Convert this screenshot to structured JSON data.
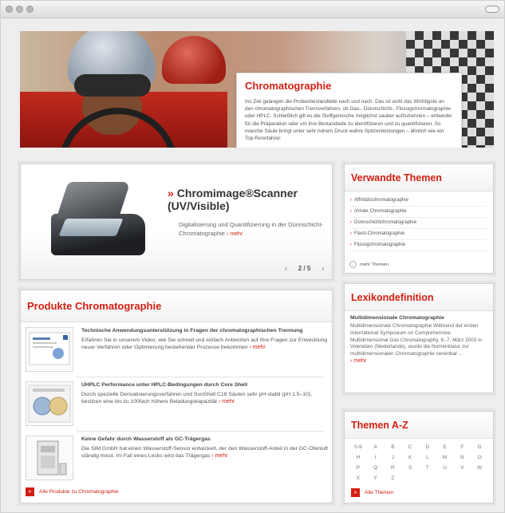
{
  "hero": {
    "title": "Chromatographie",
    "text": "Ins Ziel gelangen die Probenbestandteile nach und nach: Das ist wohl das Wichtigste an den chromatographischen Trennverfahren, ob Gas-, Dünnschicht-, Flüssigchromatographie oder HPLC. Schließlich gilt es die Stoffgemische möglichst sauber aufzutrennen – entweder für die Präparation oder um ihre Bestandteile zu identifizieren und zu quantifizieren. So manche Säule bringt unter sehr hohem Druck wahre Spitzenleistungen – ähnlich wie ein Top-Rennfahrer."
  },
  "scanner": {
    "title": "Chromimage®Scanner (UV/Visible)",
    "description": "Digitalisierung und Quantifizierung in der Dünnschicht-Chromatographie",
    "more": "› mehr",
    "pager": "2 / 5",
    "prev": "‹",
    "next": "›"
  },
  "related": {
    "title": "Verwandte Themen",
    "items": [
      "Affinitätschromatographie",
      "chirale Chromatographie",
      "Dünnschichtchromatographie",
      "Flash-Chromatographie",
      "Flüssigchromatographie"
    ],
    "more": "mehr Themen"
  },
  "lexikon": {
    "title": "Lexikondefinition",
    "term": "Multidimensionale Chromatographie",
    "text": "Multidimensionale Chromatographie Während der ersten International Symposium on Comprehensive Multidimensional Gas Chromatography, 6.-7. März 2003 in Volendam (Niederlande), wurde die Nomenklatur zur multidimensionalen Chromatographie vereinbar ...",
    "more": "› mehr"
  },
  "themen": {
    "title": "Themen A-Z",
    "letters": [
      "0-9",
      "A",
      "B",
      "C",
      "D",
      "E",
      "F",
      "G",
      "H",
      "I",
      "J",
      "K",
      "L",
      "M",
      "N",
      "O",
      "P",
      "Q",
      "R",
      "S",
      "T",
      "U",
      "V",
      "W",
      "X",
      "Y",
      "Z"
    ],
    "all_label": "Alle Themen"
  },
  "products": {
    "title": "Produkte Chromatographie",
    "items": [
      {
        "title": "Technische Anwendungsunterstützung in Fragen der chromatographischen Trennung",
        "text": "Erfahren Sie in unserem Video, wie Sie schnell und einfach Antworten auf Ihre Fragen zur Entwicklung neuer Verfahren oder Optimierung bestehender Prozesse bekommen",
        "more": "› mehr"
      },
      {
        "title": "UHPLC Performance unter HPLC-Bedingungen durch Core Shell",
        "text": "Durch spezielle Derivatisierungsverfahren und SunShell C18 Säulen sehr pH-stabil (pH 1.5–10), besitzen eine bis zu 100fach höhere Beladungskapazität",
        "more": "› mehr"
      },
      {
        "title": "Keine Gefahr durch Wasserstoff als GC-Trägergas",
        "text": "Die SIM GmbH hat einen Wasserstoff-Sensor entwickelt, der den Wasserstoff-Anteil in der GC-Ofenluft ständig misst. Im Fall eines Lecks wird das Trägergas",
        "more": "› mehr"
      }
    ],
    "all_label": "Alle Produkte zu Chromatographie"
  },
  "colors": {
    "accent": "#d21f12",
    "background": "#eeeeee"
  }
}
